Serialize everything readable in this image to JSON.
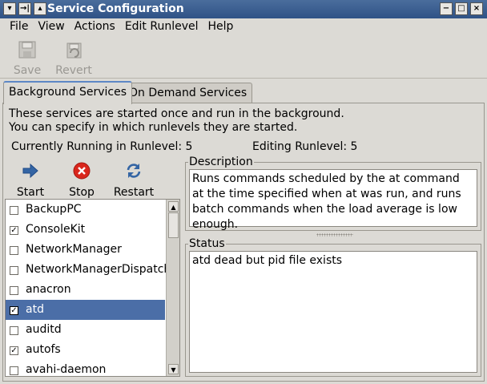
{
  "window": {
    "title": "Service Configuration",
    "left_controls": [
      "▾",
      "→|",
      "▴"
    ],
    "right_controls": [
      "−",
      "□",
      "×"
    ]
  },
  "menu": [
    "File",
    "View",
    "Actions",
    "Edit Runlevel",
    "Help"
  ],
  "toolbar": {
    "save_label": "Save",
    "revert_label": "Revert"
  },
  "tabs": [
    "Background Services",
    "On Demand Services"
  ],
  "intro": {
    "line1": "These services are started once and run in the background.",
    "line2": "You can specify in which runlevels they are started."
  },
  "runlevel": {
    "current": "Currently Running in Runlevel: 5",
    "editing": "Editing Runlevel: 5"
  },
  "actions": {
    "start": "Start",
    "stop": "Stop",
    "restart": "Restart"
  },
  "services": [
    {
      "name": "BackupPC",
      "checked": false
    },
    {
      "name": "ConsoleKit",
      "checked": true
    },
    {
      "name": "NetworkManager",
      "checked": false
    },
    {
      "name": "NetworkManagerDispatcher",
      "checked": false
    },
    {
      "name": "anacron",
      "checked": false
    },
    {
      "name": "atd",
      "checked": true,
      "selected": true
    },
    {
      "name": "auditd",
      "checked": false
    },
    {
      "name": "autofs",
      "checked": true
    },
    {
      "name": "avahi-daemon",
      "checked": false
    }
  ],
  "description": {
    "label": "Description",
    "text": "Runs commands scheduled by the at command at the time specified when at was run, and runs batch commands when the load average is low enough."
  },
  "status": {
    "label": "Status",
    "text": "atd dead but pid file exists"
  },
  "colors": {
    "titlebar": "#3a5f94",
    "selection": "#4b6ea7",
    "stop_icon": "#d9261c",
    "start_icon": "#3465a4"
  }
}
